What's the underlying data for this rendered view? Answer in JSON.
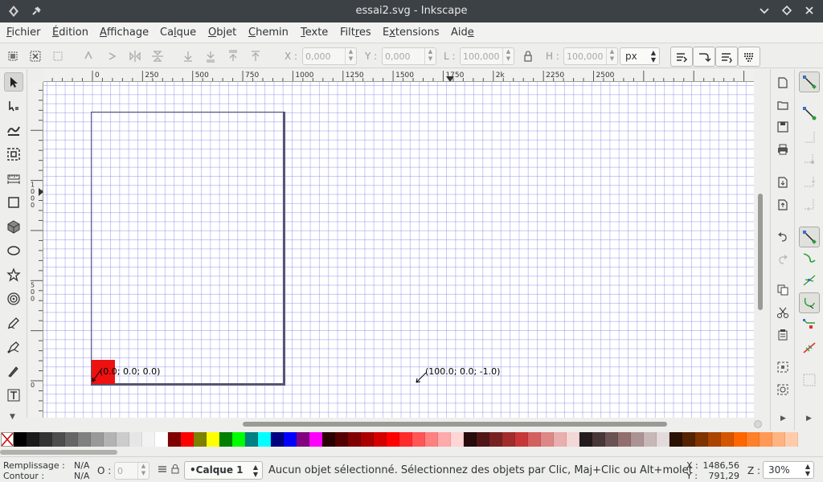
{
  "window": {
    "title": "essai2.svg - Inkscape"
  },
  "menu": {
    "items": [
      {
        "pre": "",
        "u": "F",
        "post": "ichier"
      },
      {
        "pre": "",
        "u": "É",
        "post": "dition"
      },
      {
        "pre": "",
        "u": "A",
        "post": "ffichage"
      },
      {
        "pre": "Ca",
        "u": "l",
        "post": "que"
      },
      {
        "pre": "",
        "u": "O",
        "post": "bjet"
      },
      {
        "pre": "",
        "u": "C",
        "post": "hemin"
      },
      {
        "pre": "",
        "u": "T",
        "post": "exte"
      },
      {
        "pre": "Filt",
        "u": "r",
        "post": "es"
      },
      {
        "pre": "E",
        "u": "x",
        "post": "tensions"
      },
      {
        "pre": "Aid",
        "u": "e",
        "post": ""
      }
    ]
  },
  "select_toolbar": {
    "x_label": "X :",
    "x_value": "0,000",
    "y_label": "Y :",
    "y_value": "0,000",
    "w_label": "L :",
    "w_value": "100,000",
    "h_label": "H :",
    "h_value": "100,000",
    "unit": "px"
  },
  "hruler": {
    "ticks": [
      {
        "label": "0",
        "value": 0
      },
      {
        "label": "250",
        "value": 250
      },
      {
        "label": "500",
        "value": 500
      },
      {
        "label": "750",
        "value": 750
      },
      {
        "label": "1000",
        "value": 1000
      },
      {
        "label": "1250",
        "value": 1250
      },
      {
        "label": "1500",
        "value": 1500
      },
      {
        "label": "1750",
        "value": 1750
      },
      {
        "label": "2k",
        "value": 2000
      },
      {
        "label": "2250",
        "value": 2250
      },
      {
        "label": "2500",
        "value": 2500
      }
    ]
  },
  "vruler": {
    "ticks": [
      {
        "label": "1000",
        "value": 1000
      },
      {
        "label": "500",
        "value": 500
      },
      {
        "label": "0",
        "value": 0
      }
    ]
  },
  "canvas": {
    "label_left": "(0.0; 0.0; 0.0)",
    "label_right": "(100.0; 0.0; -1.0)"
  },
  "palette": {
    "colors": [
      "#000000",
      "#1a1a1a",
      "#333333",
      "#4d4d4d",
      "#666666",
      "#808080",
      "#999999",
      "#b3b3b3",
      "#cccccc",
      "#e6e6e6",
      "#f2f2f2",
      "#ffffff",
      "#800000",
      "#ff0000",
      "#808000",
      "#ffff00",
      "#008000",
      "#00ff00",
      "#008080",
      "#00ffff",
      "#000080",
      "#0000ff",
      "#800080",
      "#ff00ff",
      "#2b0000",
      "#550000",
      "#800000",
      "#aa0000",
      "#d40000",
      "#ff0000",
      "#ff2a2a",
      "#ff5555",
      "#ff8080",
      "#ffaaaa",
      "#ffd5d5",
      "#280b0b",
      "#501616",
      "#782121",
      "#a02c2c",
      "#c83737",
      "#d35f5f",
      "#de8787",
      "#e9afaf",
      "#f4d7d7",
      "#241c1c",
      "#483737",
      "#6c5353",
      "#916f6f",
      "#ac9393",
      "#c8b7b7",
      "#e3dbdb",
      "#2b1100",
      "#552200",
      "#803300",
      "#aa4400",
      "#d45500",
      "#ff6600",
      "#ff7f2a",
      "#ff9955",
      "#ffb380",
      "#ffccaa"
    ]
  },
  "status": {
    "fill_label": "Remplissage :",
    "fill_value": "N/A",
    "stroke_label": "Contour :",
    "stroke_value": "N/A",
    "opacity_label": "O :",
    "opacity_value": "0",
    "layer": "•Calque 1",
    "message": "Aucun objet sélectionné. Sélectionnez des objets par Clic, Maj+Clic ou Alt+molet",
    "x_label": "X :",
    "x_value": "1486,56",
    "y_label": "Y :",
    "y_value": "791,29",
    "zoom_label": "Z :",
    "zoom_value": "30%"
  }
}
